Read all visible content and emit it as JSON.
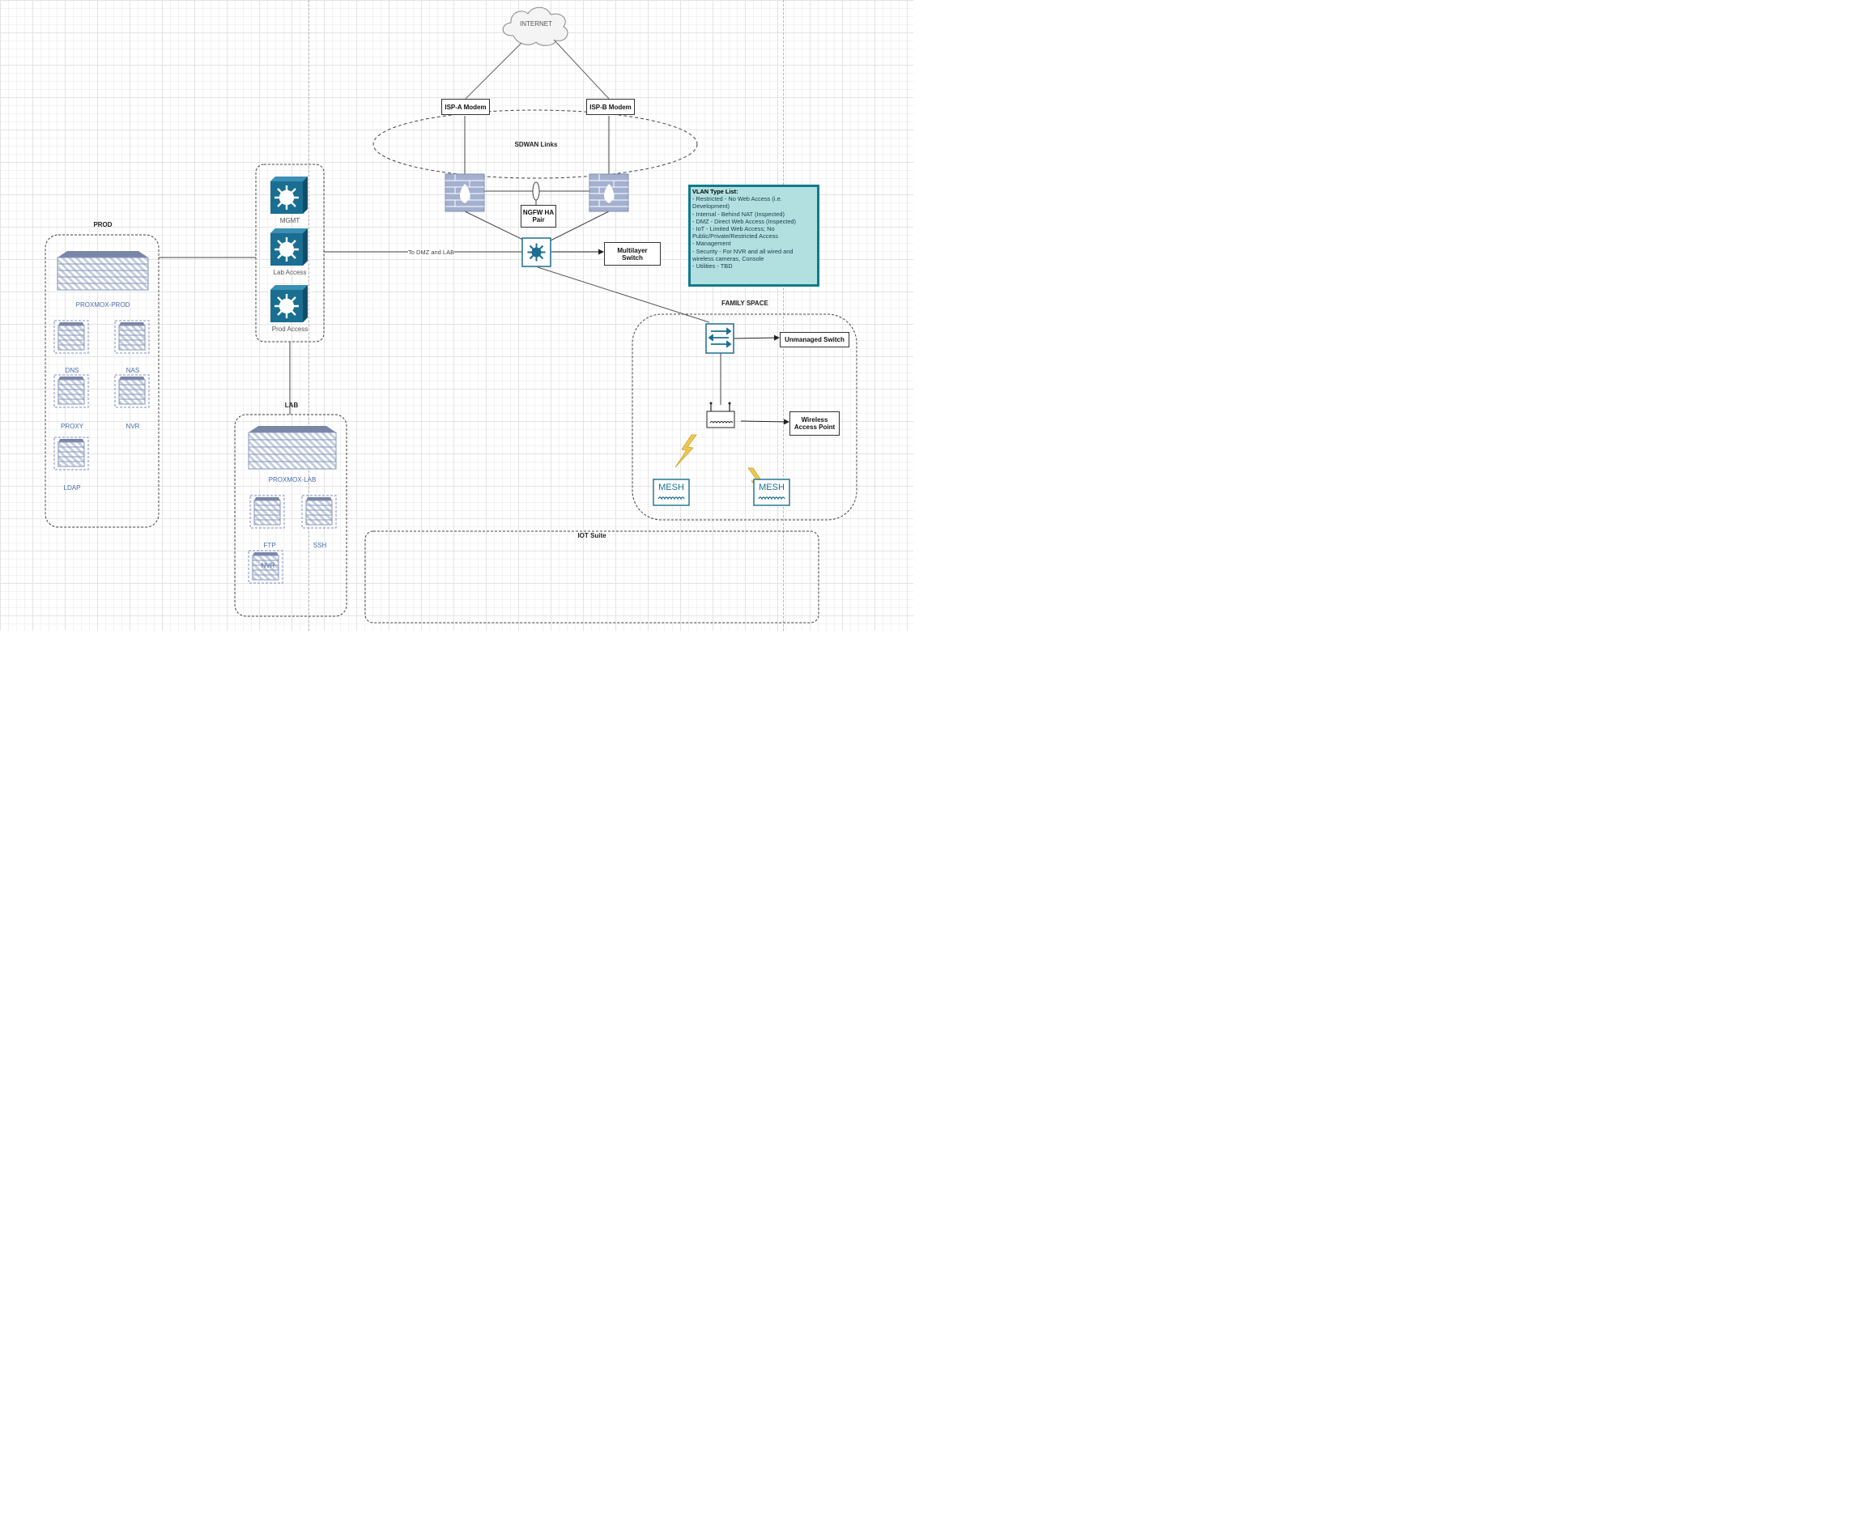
{
  "diagram": {
    "internet_label": "INTERNET",
    "isp_a": "ISP-A Modem",
    "isp_b": "ISP-B Modem",
    "sdwan": "SDWAN Links",
    "ngfw_ha": [
      "NGFW HA",
      "Pair"
    ],
    "multilayer_switch": [
      "Multilayer",
      "Switch"
    ],
    "edge_link_label": "To DMZ and LAB",
    "core_switches": [
      "MGMT",
      "Lab Access",
      "Prod Access"
    ],
    "prod": {
      "title": "PROD",
      "host": "PROXMOX-PROD",
      "vms": [
        "DNS",
        "NAS",
        "PROXY",
        "NVR",
        "LDAP"
      ]
    },
    "lab": {
      "title": "LAB",
      "host": "PROXMOX-LAB",
      "vms": [
        "FTP",
        "SSH",
        "NVR"
      ]
    },
    "family": {
      "title": "FAMILY SPACE",
      "unmanaged_switch": "Unmanaged Switch",
      "wap": [
        "Wireless",
        "Access Point"
      ],
      "mesh": [
        "MESH",
        "MESH"
      ]
    },
    "iot": {
      "title": "IOT Suite"
    },
    "vlan": {
      "title": "VLAN Type List:",
      "lines": [
        "- Restricted - No Web Access (i.e. Development)",
        "- Internal - Behind NAT (Inspected)",
        "- DMZ - Direct Web Access (Inspected)",
        "- IoT - Limited Web Access; No Public/Private/Restricted Access",
        "- Management",
        "- Security - For NVR and all wired and wireless cameras, Console",
        "- Utilities - TBD"
      ]
    },
    "colors": {
      "accent": "#1a6e92",
      "note_fill": "#b2e0e0",
      "note_border": "#117a8b",
      "server": "#8a97b8"
    }
  }
}
